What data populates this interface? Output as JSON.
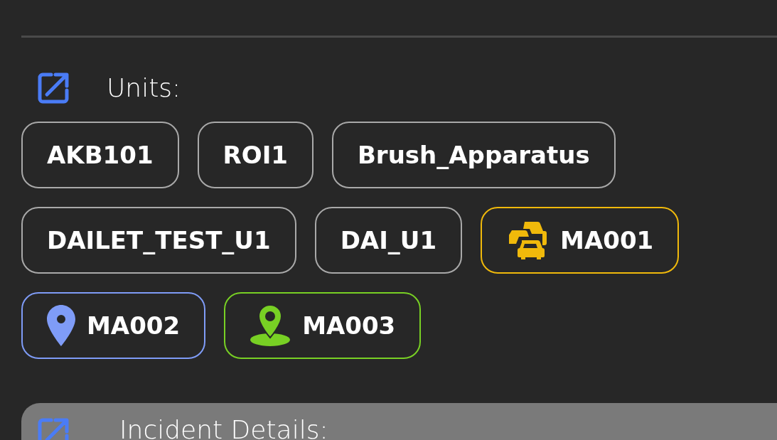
{
  "units_section": {
    "label": "Units:",
    "units": [
      {
        "label": "AKB101",
        "kind": "plain",
        "color": "#a9a9a9"
      },
      {
        "label": "ROI1",
        "kind": "plain",
        "color": "#a9a9a9"
      },
      {
        "label": "Brush_Apparatus",
        "kind": "plain",
        "color": "#a9a9a9"
      },
      {
        "label": "DAILET_TEST_U1",
        "kind": "plain",
        "color": "#a9a9a9"
      },
      {
        "label": "DAI_U1",
        "kind": "plain",
        "color": "#a9a9a9"
      },
      {
        "label": "MA001",
        "kind": "traffic",
        "color": "#f0b90b"
      },
      {
        "label": "MA002",
        "kind": "pin",
        "color": "#7f9cf7"
      },
      {
        "label": "MA003",
        "kind": "pin-base",
        "color": "#78d024"
      }
    ]
  },
  "incident_section": {
    "label": "Incident Details:"
  }
}
